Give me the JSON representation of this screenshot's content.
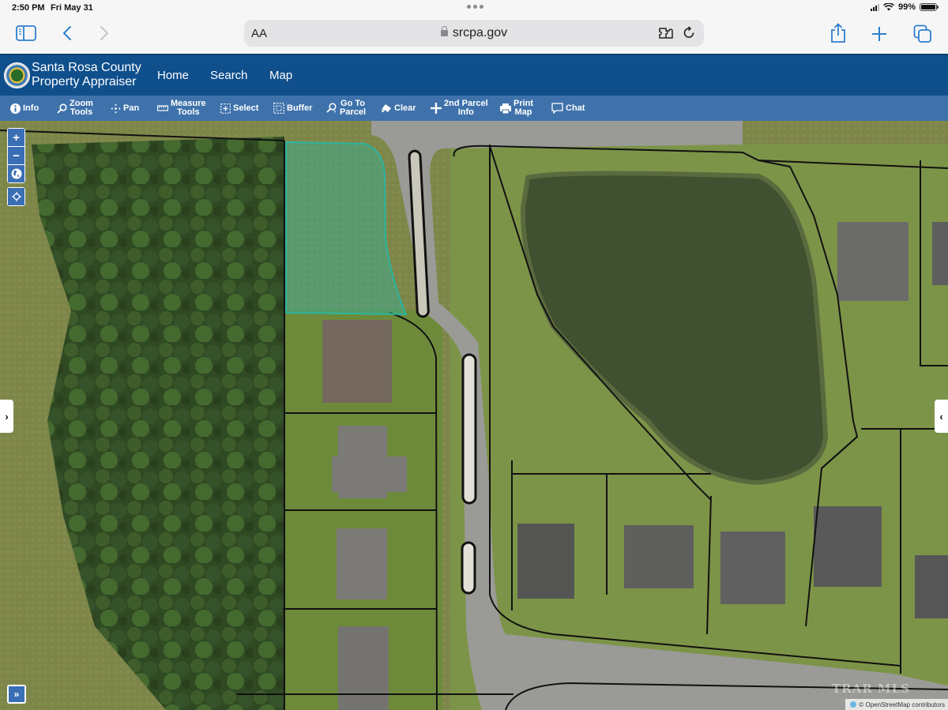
{
  "status_bar": {
    "time": "2:50 PM",
    "date": "Fri May 31",
    "battery": "99%",
    "battery_level": 0.99
  },
  "browser": {
    "text_size_label": "AA",
    "url": "srcpa.gov",
    "icons": [
      "sidebar-icon",
      "back-icon",
      "forward-icon",
      "extension-icon",
      "reload-icon",
      "share-icon",
      "new-tab-icon",
      "tabs-icon"
    ]
  },
  "header": {
    "brand_line1": "Santa Rosa County",
    "brand_line2": "Property Appraiser",
    "nav": [
      {
        "label": "Home"
      },
      {
        "label": "Search"
      },
      {
        "label": "Map"
      }
    ]
  },
  "toolbar": {
    "tools": [
      {
        "id": "info",
        "line1": "Info",
        "line2": "",
        "icon": "info-icon"
      },
      {
        "id": "zoom-tools",
        "line1": "Zoom",
        "line2": "Tools",
        "icon": "magnifier-icon"
      },
      {
        "id": "pan",
        "line1": "Pan",
        "line2": "",
        "icon": "pan-icon"
      },
      {
        "id": "measure-tools",
        "line1": "Measure",
        "line2": "Tools",
        "icon": "ruler-icon"
      },
      {
        "id": "select",
        "line1": "Select",
        "line2": "",
        "icon": "select-box-icon"
      },
      {
        "id": "buffer",
        "line1": "Buffer",
        "line2": "",
        "icon": "buffer-icon"
      },
      {
        "id": "go-to-parcel",
        "line1": "Go To",
        "line2": "Parcel",
        "icon": "find-parcel-icon"
      },
      {
        "id": "clear",
        "line1": "Clear",
        "line2": "",
        "icon": "eraser-icon"
      },
      {
        "id": "2nd-parcel-info",
        "line1": "2nd Parcel",
        "line2": "Info",
        "icon": "plus-icon"
      },
      {
        "id": "print-map",
        "line1": "Print",
        "line2": "Map",
        "icon": "printer-icon"
      },
      {
        "id": "chat",
        "line1": "Chat",
        "line2": "",
        "icon": "chat-icon"
      }
    ]
  },
  "map": {
    "controls": {
      "zoom_in": "+",
      "zoom_out": "−",
      "expand": "»",
      "left_panel_toggle": "›",
      "right_panel_toggle": "‹"
    },
    "selected_parcel_color": "#2bb5a0",
    "parcel_line_color": "#111111",
    "attribution": "© OpenStreetMap contributors",
    "watermark": "TRAR MLS"
  },
  "colors": {
    "header_bg": "#0f4f8c",
    "toolbar_bg": "#3f72ab",
    "control_blue": "#3b6fb5",
    "safari_accent": "#2f7fcf"
  }
}
